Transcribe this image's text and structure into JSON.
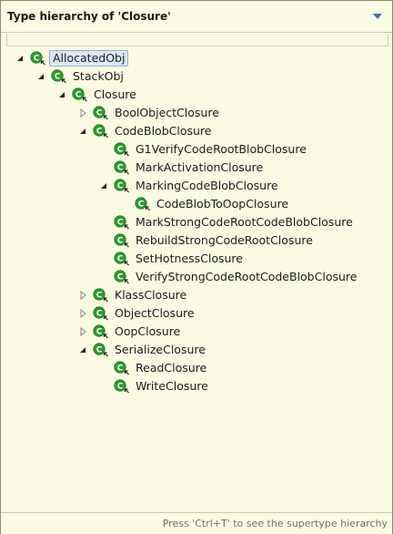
{
  "header": {
    "title": "Type hierarchy of 'Closure'",
    "menu_icon": "view-menu-triangle-icon"
  },
  "colors": {
    "background": "#fbfbe3",
    "class_icon": "#2e9b2e",
    "selection": "#dde8f5"
  },
  "tree": {
    "nodes": [
      {
        "label": "AllocatedObj",
        "level": 0,
        "state": "expanded",
        "selected": true
      },
      {
        "label": "StackObj",
        "level": 1,
        "state": "expanded"
      },
      {
        "label": "Closure",
        "level": 2,
        "state": "expanded"
      },
      {
        "label": "BoolObjectClosure",
        "level": 3,
        "state": "collapsed"
      },
      {
        "label": "CodeBlobClosure",
        "level": 3,
        "state": "expanded"
      },
      {
        "label": "G1VerifyCodeRootBlobClosure",
        "level": 4,
        "state": "leaf"
      },
      {
        "label": "MarkActivationClosure",
        "level": 4,
        "state": "leaf"
      },
      {
        "label": "MarkingCodeBlobClosure",
        "level": 4,
        "state": "expanded"
      },
      {
        "label": "CodeBlobToOopClosure",
        "level": 5,
        "state": "leaf"
      },
      {
        "label": "MarkStrongCodeRootCodeBlobClosure",
        "level": 4,
        "state": "leaf"
      },
      {
        "label": "RebuildStrongCodeRootClosure",
        "level": 4,
        "state": "leaf"
      },
      {
        "label": "SetHotnessClosure",
        "level": 4,
        "state": "leaf"
      },
      {
        "label": "VerifyStrongCodeRootCodeBlobClosure",
        "level": 4,
        "state": "leaf"
      },
      {
        "label": "KlassClosure",
        "level": 3,
        "state": "collapsed"
      },
      {
        "label": "ObjectClosure",
        "level": 3,
        "state": "collapsed"
      },
      {
        "label": "OopClosure",
        "level": 3,
        "state": "collapsed"
      },
      {
        "label": "SerializeClosure",
        "level": 3,
        "state": "expanded"
      },
      {
        "label": "ReadClosure",
        "level": 4,
        "state": "leaf"
      },
      {
        "label": "WriteClosure",
        "level": 4,
        "state": "leaf"
      }
    ]
  },
  "status": {
    "hint": "Press 'Ctrl+T' to see the supertype hierarchy"
  }
}
